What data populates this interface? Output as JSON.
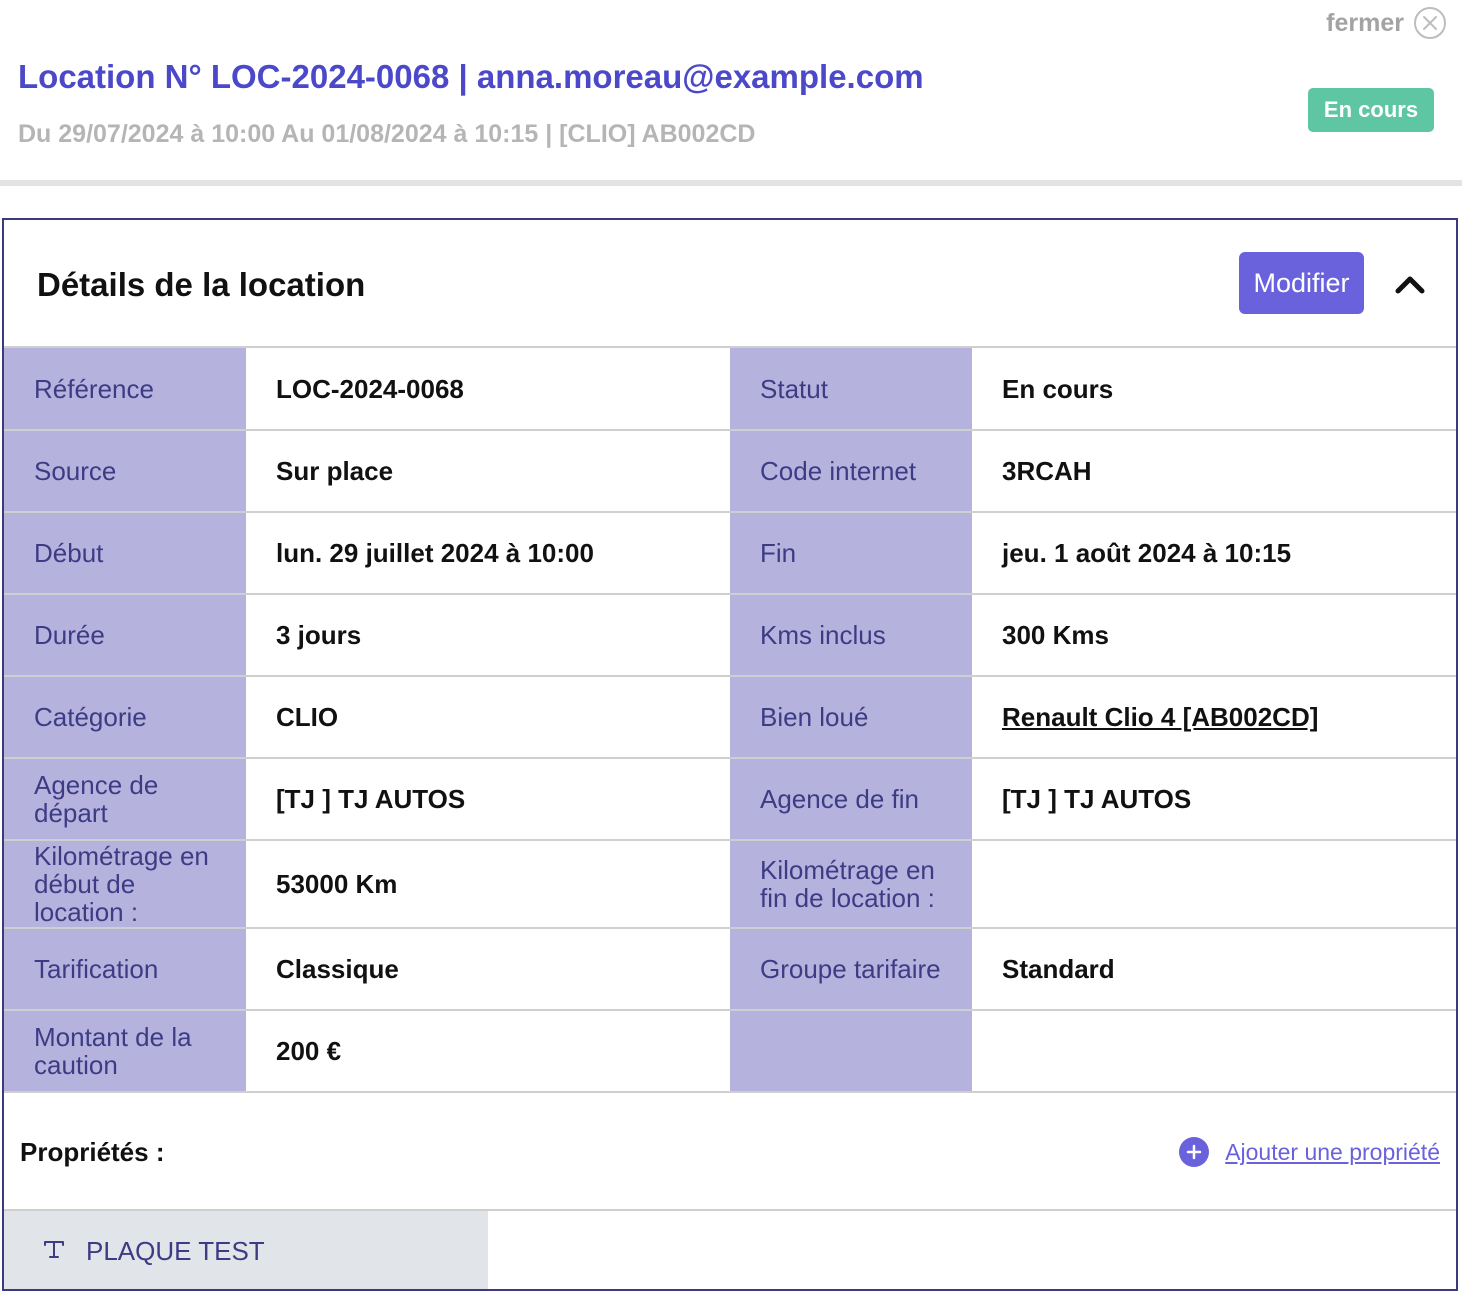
{
  "header": {
    "close_label": "fermer",
    "title": "Location N° LOC-2024-0068 | anna.moreau@example.com",
    "subtitle": "Du 29/07/2024 à 10:00 Au 01/08/2024 à 10:15 | [CLIO] AB002CD",
    "status": "En cours"
  },
  "card": {
    "title": "Détails de la location",
    "modify_label": "Modifier",
    "collapse_icon": "chevron-up-icon"
  },
  "details": {
    "rows": [
      {
        "label_left": "Référence",
        "value_left": "LOC-2024-0068",
        "label_right": "Statut",
        "value_right": "En cours"
      },
      {
        "label_left": "Source",
        "value_left": "Sur place",
        "label_right": "Code internet",
        "value_right": "3RCAH"
      },
      {
        "label_left": "Début",
        "value_left": "lun. 29 juillet 2024 à 10:00",
        "label_right": "Fin",
        "value_right": "jeu. 1 août 2024 à 10:15"
      },
      {
        "label_left": "Durée",
        "value_left": "3 jours",
        "label_right": "Kms inclus",
        "value_right": "300 Kms"
      },
      {
        "label_left": "Catégorie",
        "value_left": "CLIO",
        "label_right": "Bien loué",
        "value_right": "Renault Clio 4 [AB002CD]"
      },
      {
        "label_left": "Agence de départ",
        "value_left": "[TJ ] TJ AUTOS",
        "label_right": "Agence de fin",
        "value_right": "[TJ ] TJ AUTOS"
      },
      {
        "label_left": "Kilométrage en début de location :",
        "value_left": "53000 Km",
        "label_right": "Kilométrage en fin de location :",
        "value_right": ""
      },
      {
        "label_left": "Tarification",
        "value_left": "Classique",
        "label_right": "Groupe tarifaire",
        "value_right": "Standard"
      },
      {
        "label_left": "Montant de la caution",
        "value_left": "200 €",
        "label_right": "",
        "value_right": ""
      }
    ]
  },
  "properties": {
    "label": "Propriétés :",
    "add_label": "Ajouter une propriété",
    "items": [
      {
        "icon": "text-type-icon",
        "label": "PLAQUE TEST"
      }
    ]
  },
  "colors": {
    "title": "#4b48c9",
    "status_pill": "#5fc6a3",
    "accent": "#6a62dd",
    "label_cell_bg": "#b5b3de",
    "label_cell_text": "#3e3b85",
    "card_border": "#3b3a7d"
  }
}
